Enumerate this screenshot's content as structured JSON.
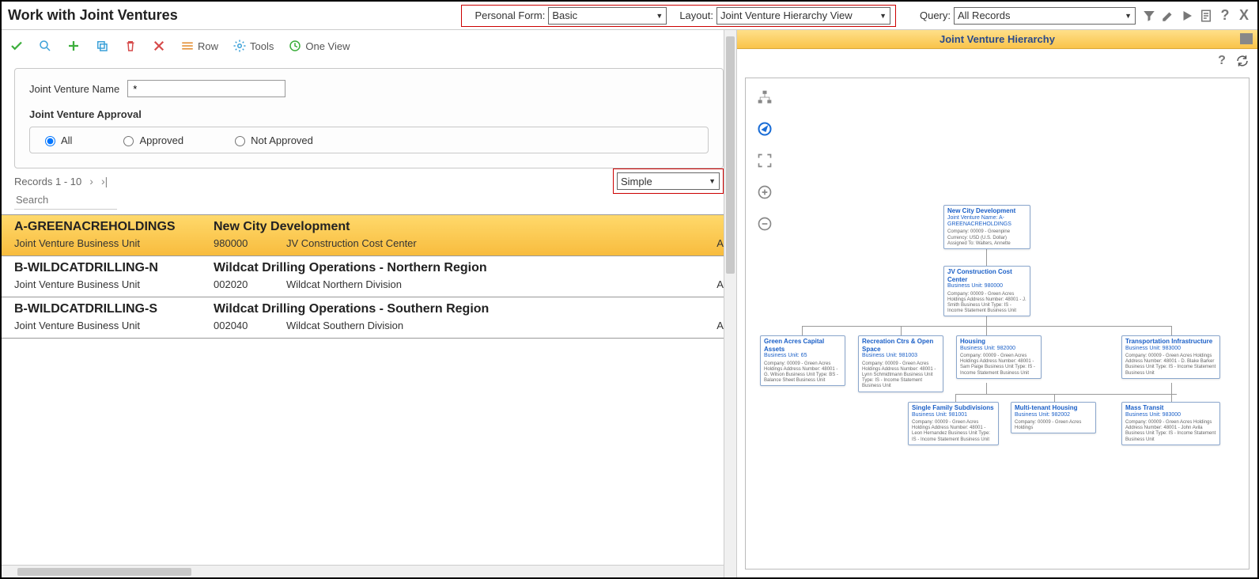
{
  "header": {
    "title": "Work with Joint Ventures",
    "personal_form_label": "Personal Form:",
    "personal_form_value": "Basic",
    "layout_label": "Layout:",
    "layout_value": "Joint Venture Hierarchy View",
    "query_label": "Query:",
    "query_value": "All Records"
  },
  "actions": {
    "row": "Row",
    "tools": "Tools",
    "one_view": "One View"
  },
  "filter": {
    "jv_name_label": "Joint Venture Name",
    "jv_name_value": "*",
    "approval_title": "Joint Venture Approval",
    "opt_all": "All",
    "opt_approved": "Approved",
    "opt_not_approved": "Not Approved"
  },
  "records": {
    "label": "Records 1 - 10",
    "view_mode": "Simple",
    "search_placeholder": "Search"
  },
  "rows": [
    {
      "code": "A-GREENACREHOLDINGS",
      "name": "New City Development",
      "label": "Joint Venture Business Unit",
      "bu": "980000",
      "desc": "JV Construction Cost Center",
      "status": "Act"
    },
    {
      "code": "B-WILDCATDRILLING-N",
      "name": "Wildcat Drilling Operations - Northern Region",
      "label": "Joint Venture Business Unit",
      "bu": "002020",
      "desc": "Wildcat Northern Division",
      "status": "Act"
    },
    {
      "code": "B-WILDCATDRILLING-S",
      "name": "Wildcat Drilling Operations - Southern Region",
      "label": "Joint Venture Business Unit",
      "bu": "002040",
      "desc": "Wildcat Southern Division",
      "status": "Act"
    }
  ],
  "hierarchy": {
    "title": "Joint Venture Hierarchy",
    "nodes": {
      "root": {
        "title": "New City Development",
        "sub": "Joint Venture Name: A-GREENACREHOLDINGS",
        "body": "Company: 00009 - Greenpine\nCurrency: USD (U.S. Dollar)\nAssigned To: Walters, Annette"
      },
      "cc": {
        "title": "JV Construction Cost Center",
        "sub": "Business Unit: 980000",
        "body": "Company: 00009 - Green Acres Holdings\nAddress Number: 48001 - J. Smith\nBusiness Unit Type: IS - Income Statement Business Unit"
      },
      "a": {
        "title": "Green Acres Capital Assets",
        "sub": "Business Unit: 65",
        "body": "Company: 00009 - Green Acres Holdings\nAddress Number: 48001 - G. Wilson\nBusiness Unit Type: BS - Balance Sheet Business Unit"
      },
      "b": {
        "title": "Recreation Ctrs & Open Space",
        "sub": "Business Unit: 981003",
        "body": "Company: 00009 - Green Acres Holdings\nAddress Number: 48001 - Lynn Schmidtmann\nBusiness Unit Type: IS - Income Statement Business Unit"
      },
      "c": {
        "title": "Housing",
        "sub": "Business Unit: 982000",
        "body": "Company: 00009 - Green Acres Holdings\nAddress Number: 48001 - Sam Paige\nBusiness Unit Type: IS - Income Statement Business Unit"
      },
      "d": {
        "title": "Transportation Infrastructure",
        "sub": "Business Unit: 983000",
        "body": "Company: 00009 - Green Acres Holdings\nAddress Number: 48001 - D. Blake Barker\nBusiness Unit Type: IS - Income Statement Business Unit"
      },
      "e": {
        "title": "Single Family Subdivisions",
        "sub": "Business Unit: 981001",
        "body": "Company: 00009 - Green Acres Holdings\nAddress Number: 48001 - Leon Hernandez\nBusiness Unit Type: IS - Income Statement Business Unit"
      },
      "f": {
        "title": "Multi-tenant Housing",
        "sub": "Business Unit: 982002",
        "body": "Company: 00009 - Green Acres Holdings"
      },
      "g": {
        "title": "Mass Transit",
        "sub": "Business Unit: 983000",
        "body": "Company: 00009 - Green Acres Holdings\nAddress Number: 48001 - John Avila\nBusiness Unit Type: IS - Income Statement Business Unit"
      }
    }
  }
}
